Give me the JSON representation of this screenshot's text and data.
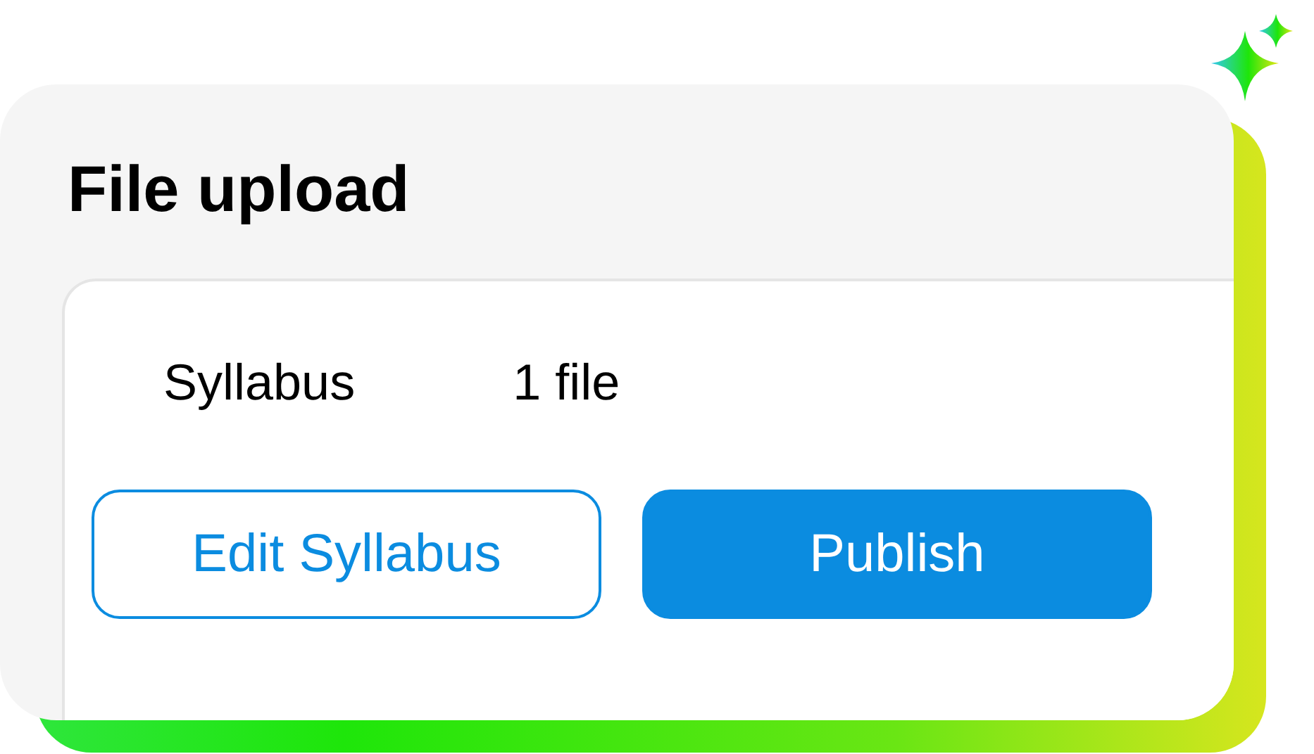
{
  "card": {
    "title": "File upload"
  },
  "item": {
    "name": "Syllabus",
    "count": "1 file"
  },
  "buttons": [
    {
      "label": "Edit Syllabus",
      "kind": "outline"
    },
    {
      "label": "Publish",
      "kind": "primary"
    }
  ]
}
